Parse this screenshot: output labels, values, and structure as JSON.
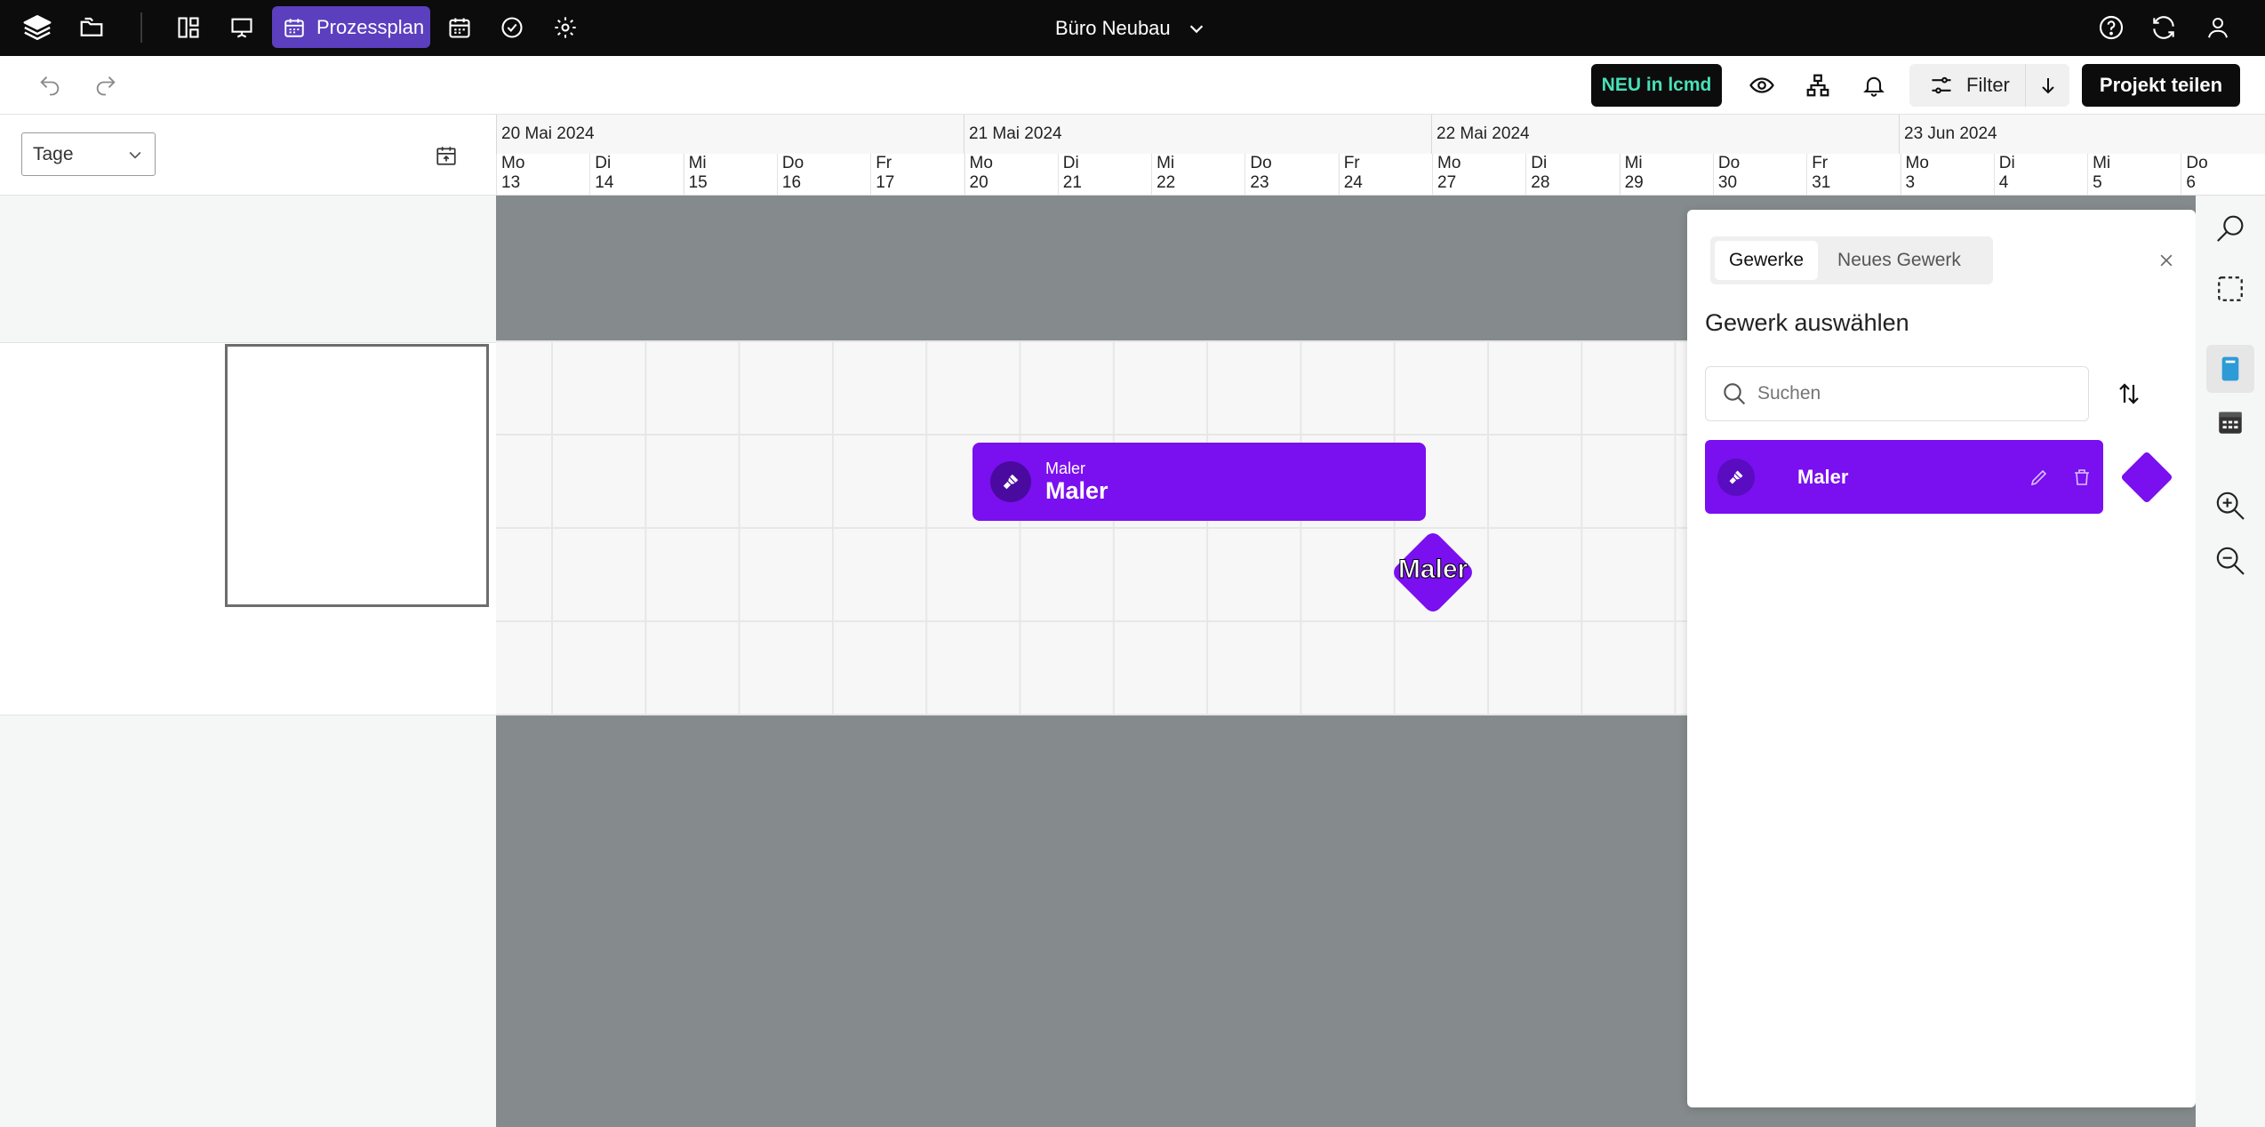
{
  "topbar": {
    "active_tab_label": "Prozessplan",
    "project_title": "Büro Neubau"
  },
  "toolbar": {
    "new_badge": "NEU in lcmd",
    "filter_label": "Filter",
    "share_label": "Projekt teilen"
  },
  "left": {
    "view_select_value": "Tage"
  },
  "timeline": {
    "weeks": [
      "20 Mai 2024",
      "21 Mai 2024",
      "22 Mai 2024",
      "23 Jun 2024"
    ],
    "days": [
      {
        "wd": "Mo",
        "d": "13"
      },
      {
        "wd": "Di",
        "d": "14"
      },
      {
        "wd": "Mi",
        "d": "15"
      },
      {
        "wd": "Do",
        "d": "16"
      },
      {
        "wd": "Fr",
        "d": "17"
      },
      {
        "wd": "Mo",
        "d": "20"
      },
      {
        "wd": "Di",
        "d": "21"
      },
      {
        "wd": "Mi",
        "d": "22"
      },
      {
        "wd": "Do",
        "d": "23"
      },
      {
        "wd": "Fr",
        "d": "24"
      },
      {
        "wd": "Mo",
        "d": "27"
      },
      {
        "wd": "Di",
        "d": "28"
      },
      {
        "wd": "Mi",
        "d": "29"
      },
      {
        "wd": "Do",
        "d": "30"
      },
      {
        "wd": "Fr",
        "d": "31"
      },
      {
        "wd": "Mo",
        "d": "3"
      },
      {
        "wd": "Di",
        "d": "4"
      },
      {
        "wd": "Mi",
        "d": "5"
      },
      {
        "wd": "Do",
        "d": "6"
      }
    ]
  },
  "canvas": {
    "task_sub": "Maler",
    "task_main": "Maler",
    "milestone_label": "Maler",
    "accent_color": "#7a0ff0"
  },
  "panel": {
    "tab_active": "Gewerke",
    "tab_other": "Neues Gewerk",
    "title": "Gewerk auswählen",
    "search_placeholder": "Suchen",
    "items": [
      {
        "label": "Maler"
      }
    ]
  }
}
